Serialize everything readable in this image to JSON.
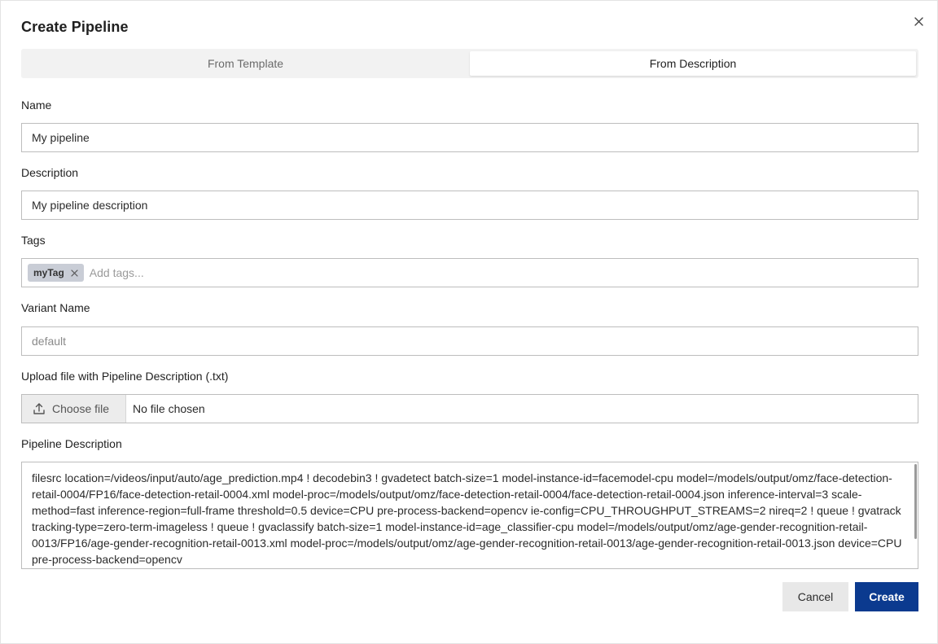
{
  "dialog": {
    "title": "Create Pipeline"
  },
  "tabs": [
    {
      "label": "From Template",
      "active": false
    },
    {
      "label": "From Description",
      "active": true
    }
  ],
  "form": {
    "name": {
      "label": "Name",
      "value": "My pipeline"
    },
    "description": {
      "label": "Description",
      "value": "My pipeline description"
    },
    "tags": {
      "label": "Tags",
      "chips": [
        "myTag"
      ],
      "placeholder": "Add tags..."
    },
    "variant": {
      "label": "Variant Name",
      "value": "",
      "placeholder": "default"
    },
    "upload": {
      "label": "Upload file with Pipeline Description (.txt)",
      "button_label": "Choose file",
      "status": "No file chosen"
    },
    "pipeline": {
      "label": "Pipeline Description",
      "value": "filesrc location=/videos/input/auto/age_prediction.mp4 ! decodebin3 ! gvadetect batch-size=1 model-instance-id=facemodel-cpu model=/models/output/omz/face-detection-retail-0004/FP16/face-detection-retail-0004.xml model-proc=/models/output/omz/face-detection-retail-0004/face-detection-retail-0004.json inference-interval=3 scale-method=fast inference-region=full-frame threshold=0.5 device=CPU pre-process-backend=opencv ie-config=CPU_THROUGHPUT_STREAMS=2 nireq=2 ! queue ! gvatrack tracking-type=zero-term-imageless ! queue ! gvaclassify batch-size=1 model-instance-id=age_classifier-cpu model=/models/output/omz/age-gender-recognition-retail-0013/FP16/age-gender-recognition-retail-0013.xml model-proc=/models/output/omz/age-gender-recognition-retail-0013/age-gender-recognition-retail-0013.json device=CPU pre-process-backend=opencv"
    }
  },
  "actions": {
    "cancel_label": "Cancel",
    "create_label": "Create"
  },
  "colors": {
    "primary": "#0b3a8f",
    "cancel_bg": "#e8e8e8",
    "tag_chip_bg": "#c9cdd6"
  },
  "icons": {
    "close": "close-icon",
    "tag_remove": "close-icon",
    "upload": "upload-icon"
  }
}
